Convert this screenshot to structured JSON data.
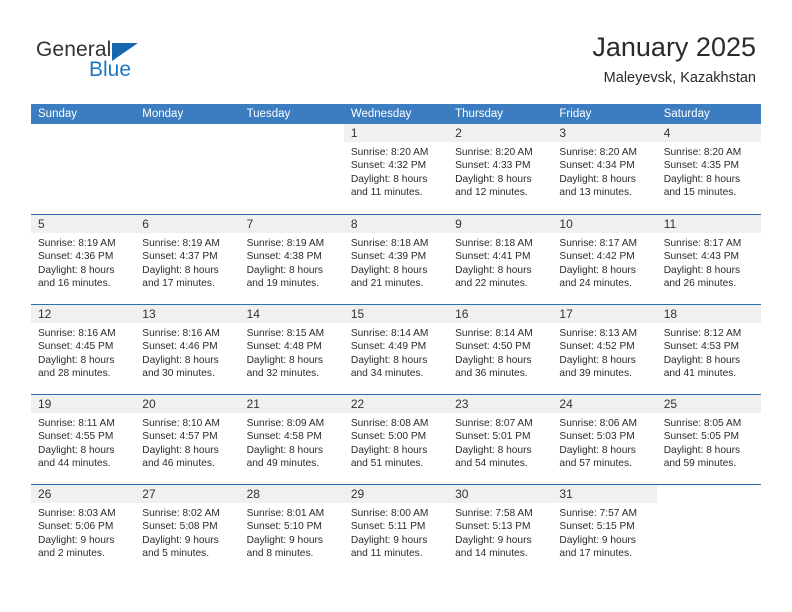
{
  "brand": {
    "name_part1": "General",
    "name_part2": "Blue",
    "logo_icon": "triangle-flag-icon",
    "accent_color": "#1567ae"
  },
  "header": {
    "title": "January 2025",
    "subtitle": "Maleyevsk, Kazakhstan"
  },
  "calendar": {
    "header_bg_color": "#3b7dc0",
    "row_divider_color": "#2f6fae",
    "daynum_band_color": "#f0f0f0",
    "weekdays": [
      "Sunday",
      "Monday",
      "Tuesday",
      "Wednesday",
      "Thursday",
      "Friday",
      "Saturday"
    ],
    "weeks": [
      [
        {
          "day": "",
          "lines": []
        },
        {
          "day": "",
          "lines": []
        },
        {
          "day": "",
          "lines": []
        },
        {
          "day": "1",
          "lines": [
            "Sunrise: 8:20 AM",
            "Sunset: 4:32 PM",
            "Daylight: 8 hours",
            "and 11 minutes."
          ]
        },
        {
          "day": "2",
          "lines": [
            "Sunrise: 8:20 AM",
            "Sunset: 4:33 PM",
            "Daylight: 8 hours",
            "and 12 minutes."
          ]
        },
        {
          "day": "3",
          "lines": [
            "Sunrise: 8:20 AM",
            "Sunset: 4:34 PM",
            "Daylight: 8 hours",
            "and 13 minutes."
          ]
        },
        {
          "day": "4",
          "lines": [
            "Sunrise: 8:20 AM",
            "Sunset: 4:35 PM",
            "Daylight: 8 hours",
            "and 15 minutes."
          ]
        }
      ],
      [
        {
          "day": "5",
          "lines": [
            "Sunrise: 8:19 AM",
            "Sunset: 4:36 PM",
            "Daylight: 8 hours",
            "and 16 minutes."
          ]
        },
        {
          "day": "6",
          "lines": [
            "Sunrise: 8:19 AM",
            "Sunset: 4:37 PM",
            "Daylight: 8 hours",
            "and 17 minutes."
          ]
        },
        {
          "day": "7",
          "lines": [
            "Sunrise: 8:19 AM",
            "Sunset: 4:38 PM",
            "Daylight: 8 hours",
            "and 19 minutes."
          ]
        },
        {
          "day": "8",
          "lines": [
            "Sunrise: 8:18 AM",
            "Sunset: 4:39 PM",
            "Daylight: 8 hours",
            "and 21 minutes."
          ]
        },
        {
          "day": "9",
          "lines": [
            "Sunrise: 8:18 AM",
            "Sunset: 4:41 PM",
            "Daylight: 8 hours",
            "and 22 minutes."
          ]
        },
        {
          "day": "10",
          "lines": [
            "Sunrise: 8:17 AM",
            "Sunset: 4:42 PM",
            "Daylight: 8 hours",
            "and 24 minutes."
          ]
        },
        {
          "day": "11",
          "lines": [
            "Sunrise: 8:17 AM",
            "Sunset: 4:43 PM",
            "Daylight: 8 hours",
            "and 26 minutes."
          ]
        }
      ],
      [
        {
          "day": "12",
          "lines": [
            "Sunrise: 8:16 AM",
            "Sunset: 4:45 PM",
            "Daylight: 8 hours",
            "and 28 minutes."
          ]
        },
        {
          "day": "13",
          "lines": [
            "Sunrise: 8:16 AM",
            "Sunset: 4:46 PM",
            "Daylight: 8 hours",
            "and 30 minutes."
          ]
        },
        {
          "day": "14",
          "lines": [
            "Sunrise: 8:15 AM",
            "Sunset: 4:48 PM",
            "Daylight: 8 hours",
            "and 32 minutes."
          ]
        },
        {
          "day": "15",
          "lines": [
            "Sunrise: 8:14 AM",
            "Sunset: 4:49 PM",
            "Daylight: 8 hours",
            "and 34 minutes."
          ]
        },
        {
          "day": "16",
          "lines": [
            "Sunrise: 8:14 AM",
            "Sunset: 4:50 PM",
            "Daylight: 8 hours",
            "and 36 minutes."
          ]
        },
        {
          "day": "17",
          "lines": [
            "Sunrise: 8:13 AM",
            "Sunset: 4:52 PM",
            "Daylight: 8 hours",
            "and 39 minutes."
          ]
        },
        {
          "day": "18",
          "lines": [
            "Sunrise: 8:12 AM",
            "Sunset: 4:53 PM",
            "Daylight: 8 hours",
            "and 41 minutes."
          ]
        }
      ],
      [
        {
          "day": "19",
          "lines": [
            "Sunrise: 8:11 AM",
            "Sunset: 4:55 PM",
            "Daylight: 8 hours",
            "and 44 minutes."
          ]
        },
        {
          "day": "20",
          "lines": [
            "Sunrise: 8:10 AM",
            "Sunset: 4:57 PM",
            "Daylight: 8 hours",
            "and 46 minutes."
          ]
        },
        {
          "day": "21",
          "lines": [
            "Sunrise: 8:09 AM",
            "Sunset: 4:58 PM",
            "Daylight: 8 hours",
            "and 49 minutes."
          ]
        },
        {
          "day": "22",
          "lines": [
            "Sunrise: 8:08 AM",
            "Sunset: 5:00 PM",
            "Daylight: 8 hours",
            "and 51 minutes."
          ]
        },
        {
          "day": "23",
          "lines": [
            "Sunrise: 8:07 AM",
            "Sunset: 5:01 PM",
            "Daylight: 8 hours",
            "and 54 minutes."
          ]
        },
        {
          "day": "24",
          "lines": [
            "Sunrise: 8:06 AM",
            "Sunset: 5:03 PM",
            "Daylight: 8 hours",
            "and 57 minutes."
          ]
        },
        {
          "day": "25",
          "lines": [
            "Sunrise: 8:05 AM",
            "Sunset: 5:05 PM",
            "Daylight: 8 hours",
            "and 59 minutes."
          ]
        }
      ],
      [
        {
          "day": "26",
          "lines": [
            "Sunrise: 8:03 AM",
            "Sunset: 5:06 PM",
            "Daylight: 9 hours",
            "and 2 minutes."
          ]
        },
        {
          "day": "27",
          "lines": [
            "Sunrise: 8:02 AM",
            "Sunset: 5:08 PM",
            "Daylight: 9 hours",
            "and 5 minutes."
          ]
        },
        {
          "day": "28",
          "lines": [
            "Sunrise: 8:01 AM",
            "Sunset: 5:10 PM",
            "Daylight: 9 hours",
            "and 8 minutes."
          ]
        },
        {
          "day": "29",
          "lines": [
            "Sunrise: 8:00 AM",
            "Sunset: 5:11 PM",
            "Daylight: 9 hours",
            "and 11 minutes."
          ]
        },
        {
          "day": "30",
          "lines": [
            "Sunrise: 7:58 AM",
            "Sunset: 5:13 PM",
            "Daylight: 9 hours",
            "and 14 minutes."
          ]
        },
        {
          "day": "31",
          "lines": [
            "Sunrise: 7:57 AM",
            "Sunset: 5:15 PM",
            "Daylight: 9 hours",
            "and 17 minutes."
          ]
        },
        {
          "day": "",
          "lines": []
        }
      ]
    ]
  }
}
